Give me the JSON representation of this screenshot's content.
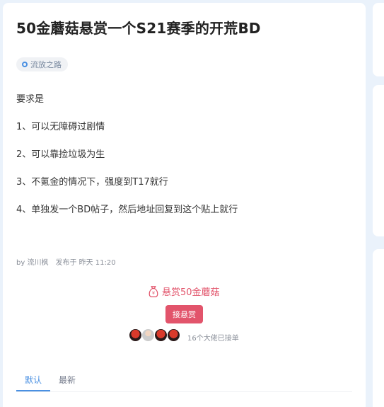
{
  "post": {
    "title": "50金蘑菇悬赏一个S21赛季的开荒BD",
    "tag": "流放之路",
    "content": [
      "要求是",
      "1、可以无障碍过剧情",
      "2、可以靠捡垃圾为生",
      "3、不氪金的情况下，强度到T17就行",
      "4、单独发一个BD帖子，然后地址回复到这个贴上就行"
    ],
    "meta": {
      "author": "by 流川枫",
      "published": "发布于 昨天 11:20"
    }
  },
  "bounty": {
    "label": "悬赏50金蘑菇",
    "accept_button": "接悬赏",
    "takers_text": "16个大佬已接单",
    "icon": "money-bag-icon"
  },
  "tabs": [
    {
      "label": "默认",
      "active": true
    },
    {
      "label": "最新",
      "active": false
    }
  ],
  "colors": {
    "accent_blue": "#4a90e2",
    "bounty_red": "#e2546b",
    "background": "#eaf2fb"
  }
}
